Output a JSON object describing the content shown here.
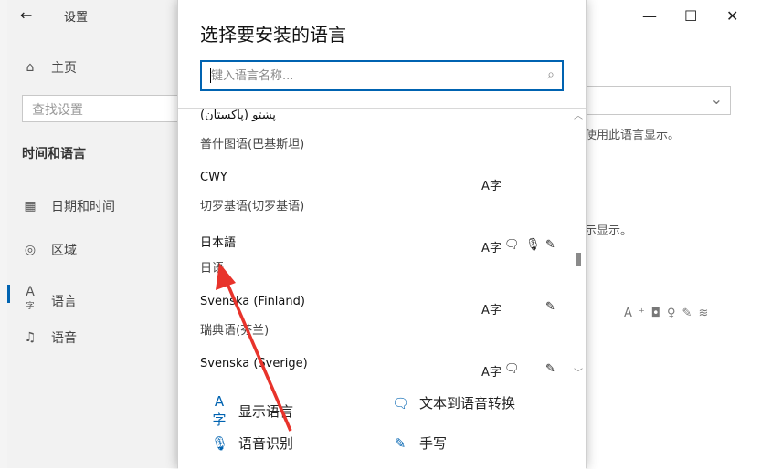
{
  "settings_window": {
    "title": "设置",
    "side_search_placeholder": "查找设置",
    "section_title": "时间和语言",
    "nav": [
      {
        "label": "主页",
        "icon": "home-icon"
      },
      {
        "label": "日期和时间",
        "icon": "calendar-clock-icon"
      },
      {
        "label": "区域",
        "icon": "globe-icon"
      },
      {
        "label": "语言",
        "icon": "language-icon",
        "selected": true
      },
      {
        "label": "语音",
        "icon": "microphone-icon"
      }
    ],
    "right_text_1": "使用此语言显示。",
    "right_text_2": "示显示。",
    "window_controls": {
      "minimize": "—",
      "maximize": "☐",
      "close": "✕"
    }
  },
  "dialog": {
    "title": "选择要安装的语言",
    "search_placeholder": "键入语言名称...",
    "languages": [
      {
        "native": "پښتو (پاکستان)",
        "chinese": "普什图语(巴基斯坦)",
        "features": []
      },
      {
        "native": "CWY",
        "chinese": "切罗基语(切罗基语)",
        "features": [
          "display"
        ]
      },
      {
        "native": "日本語",
        "chinese": "日语",
        "features": [
          "display",
          "tts",
          "speech",
          "handwriting"
        ]
      },
      {
        "native": "Svenska (Finland)",
        "chinese": "瑞典语(芬兰)",
        "features": [
          "display",
          "handwriting"
        ]
      },
      {
        "native": "Svenska (Sverige)",
        "chinese": "",
        "features": [
          "display",
          "tts",
          "handwriting"
        ]
      }
    ],
    "legend": {
      "display": "显示语言",
      "tts": "文本到语音转换",
      "speech": "语音识别",
      "handwriting": "手写"
    }
  },
  "icons": {
    "display": "A字",
    "tts": "🗨",
    "speech": "🎙",
    "handwriting": "✎"
  },
  "colors": {
    "accent": "#0063b1",
    "arrow": "#e8332b"
  }
}
